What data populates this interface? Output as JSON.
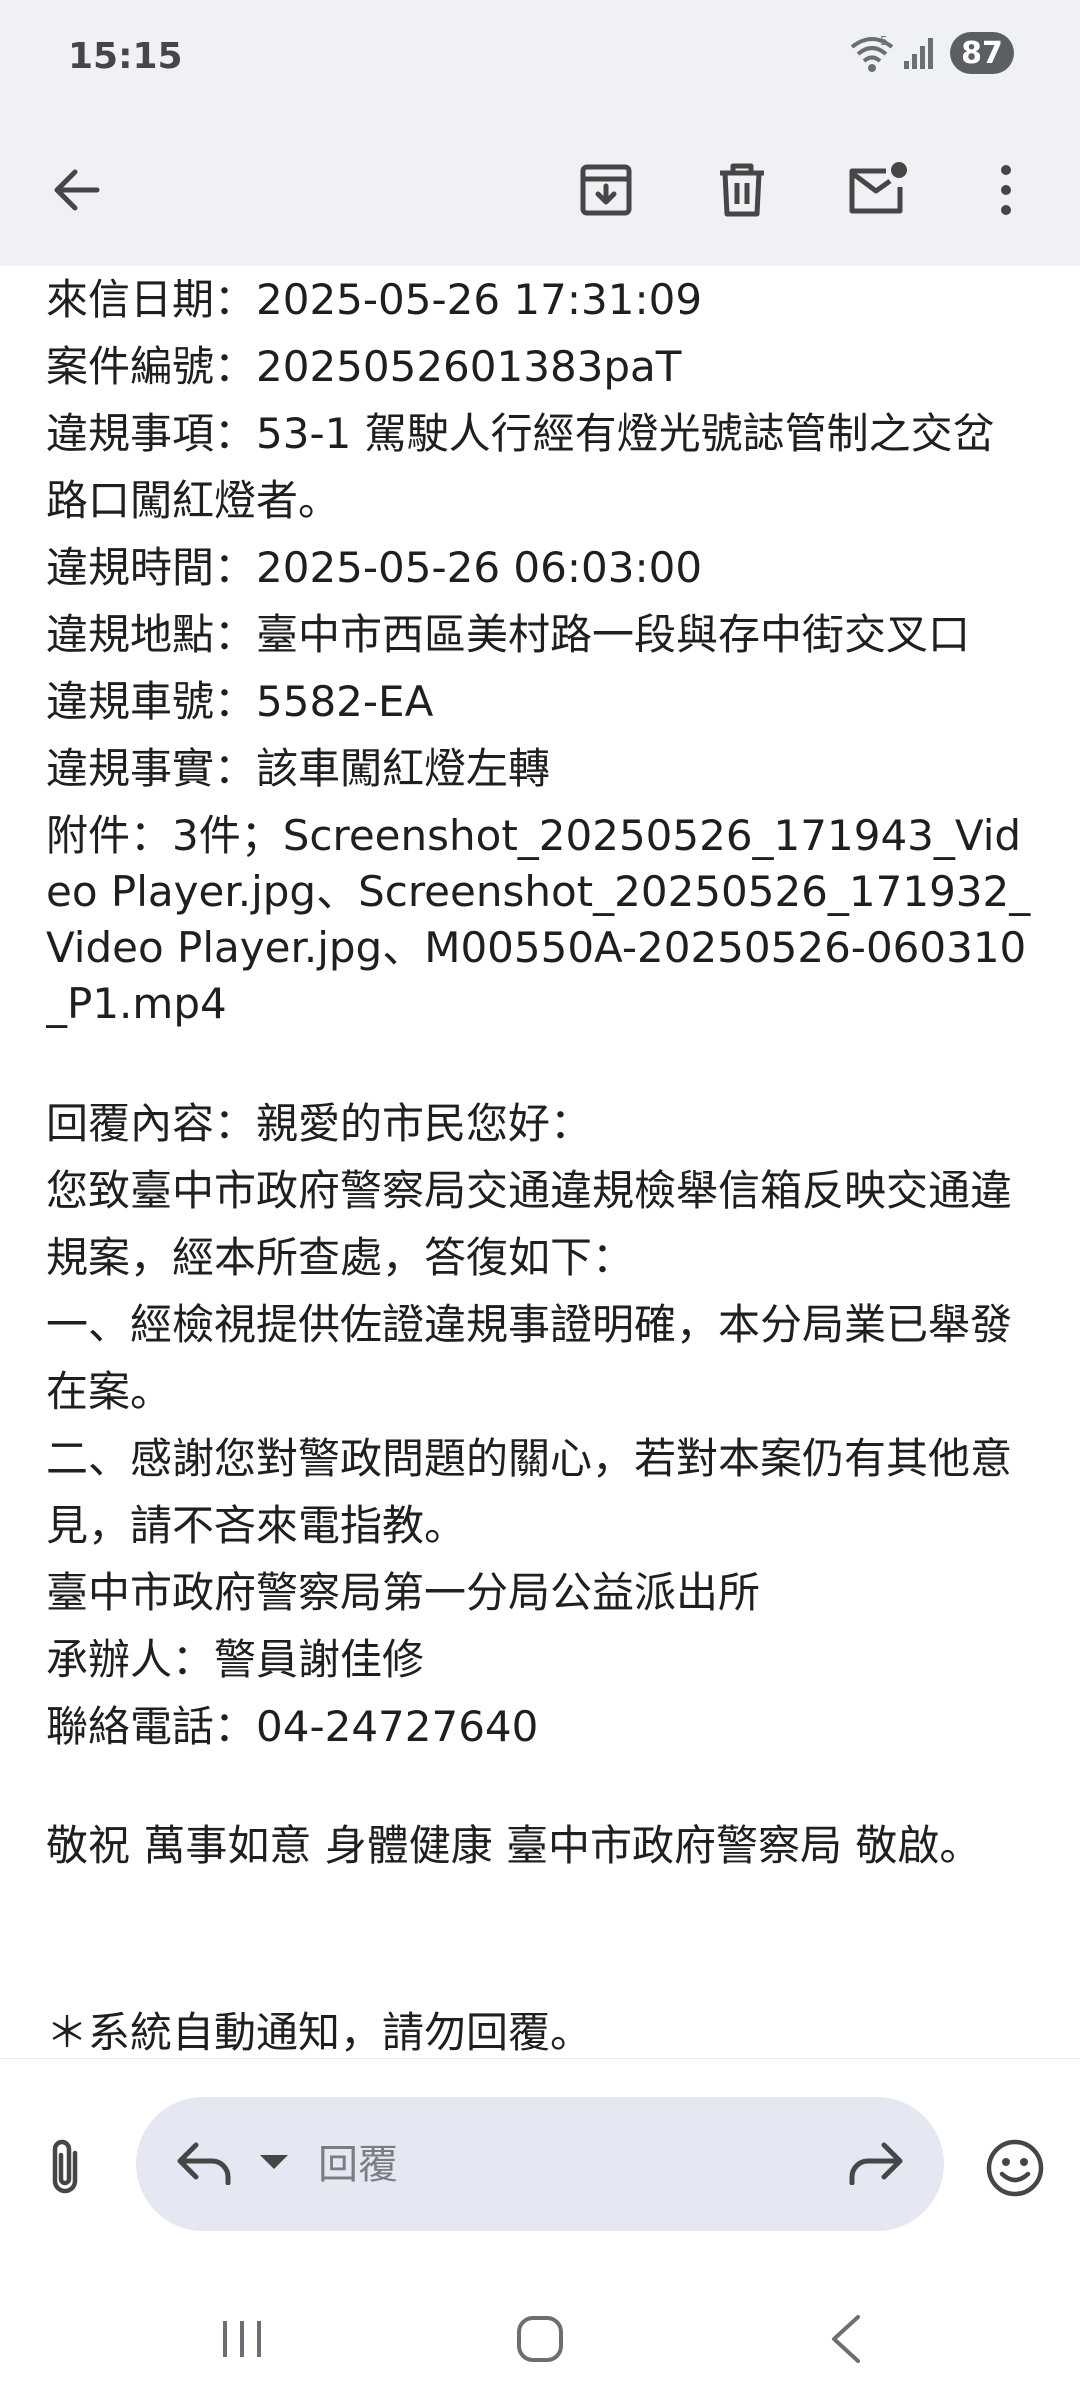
{
  "status_bar": {
    "time": "15:15",
    "battery": "87",
    "icons": [
      "wifi-5-icon",
      "signal-icon",
      "battery-icon"
    ]
  },
  "toolbar": {
    "icons": [
      "back-arrow-icon",
      "archive-icon",
      "delete-icon",
      "mark-unread-icon",
      "more-vert-icon"
    ]
  },
  "email": {
    "lines": [
      "來信日期：2025-05-26 17:31:09",
      "案件編號：2025052601383paT",
      "違規事項：53-1 駕駛人行經有燈光號誌管制之交岔路口闖紅燈者。",
      "違規時間：2025-05-26 06:03:00",
      "違規地點：臺中市西區美村路一段與存中街交叉口",
      "違規車號：5582-EA",
      "違規事實：該車闖紅燈左轉",
      "附件：3件；Screenshot_20250526_171943_Video Player.jpg、Screenshot_20250526_171932_Video Player.jpg、M00550A-20250526-060310_P1.mp4"
    ],
    "reply_lines": [
      "回覆內容：親愛的市民您好：",
      "您致臺中市政府警察局交通違規檢舉信箱反映交通違規案，經本所查處，答復如下：",
      "一、經檢視提供佐證違規事證明確，本分局業已舉發在案。",
      "二、感謝您對警政問題的關心，若對本案仍有其他意見，請不吝來電指教。",
      "臺中市政府警察局第一分局公益派出所",
      "承辦人：警員謝佳修",
      "聯絡電話：04-24727640"
    ],
    "closing": "敬祝 萬事如意 身體健康 臺中市政府警察局 敬啟。",
    "footer": "＊系統自動通知，請勿回覆。"
  },
  "reply_bar": {
    "placeholder": "回覆",
    "icons": [
      "attach-icon",
      "reply-icon",
      "dropdown-icon",
      "forward-icon",
      "emoji-icon"
    ]
  },
  "nav_bar": {
    "icons": [
      "recents-icon",
      "home-icon",
      "back-icon"
    ]
  },
  "colors": {
    "header_bg": "#eff1f4",
    "reply_pill_bg": "#e5e8f2",
    "icon": "#444746",
    "text": "#1f1f1f"
  }
}
